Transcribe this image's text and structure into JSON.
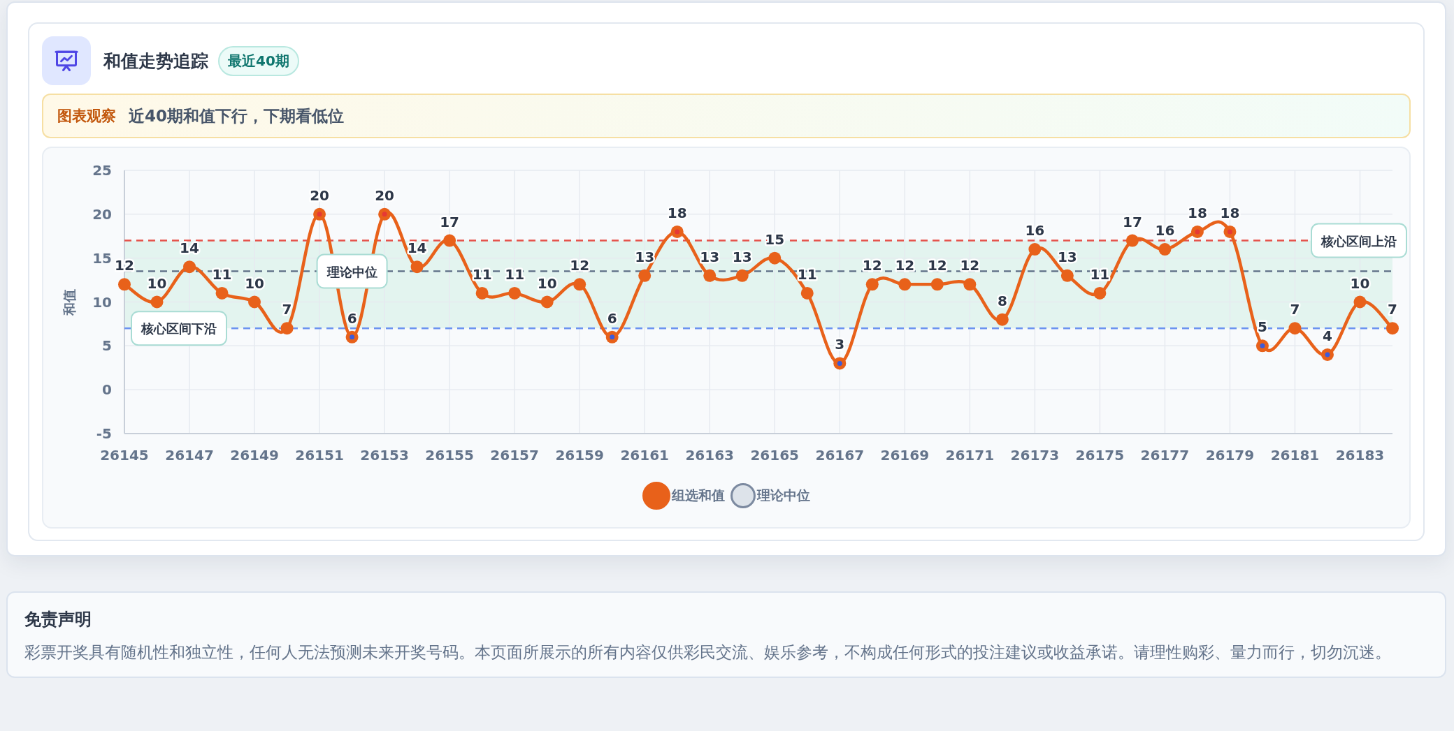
{
  "header": {
    "title": "和值走势追踪",
    "badge": "最近40期"
  },
  "observation": {
    "label": "图表观察",
    "text": "近40期和值下行，下期看低位"
  },
  "chart": {
    "chart_data": {
      "type": "line",
      "ylabel": "和值",
      "ylim": [
        -5,
        25
      ],
      "yticks": [
        -5,
        0,
        5,
        10,
        15,
        20,
        25
      ],
      "xlim": [
        26145,
        26184
      ],
      "data_labels": true,
      "grid": true,
      "x": [
        26145,
        26146,
        26147,
        26148,
        26149,
        26150,
        26151,
        26152,
        26153,
        26154,
        26155,
        26156,
        26157,
        26158,
        26159,
        26160,
        26161,
        26162,
        26163,
        26164,
        26165,
        26166,
        26167,
        26168,
        26169,
        26170,
        26171,
        26172,
        26173,
        26174,
        26175,
        26176,
        26177,
        26178,
        26179,
        26180,
        26181,
        26182,
        26183,
        26184
      ],
      "xticks": [
        26145,
        26147,
        26149,
        26151,
        26153,
        26155,
        26157,
        26159,
        26161,
        26163,
        26165,
        26167,
        26169,
        26171,
        26173,
        26175,
        26177,
        26179,
        26181,
        26183
      ],
      "series": [
        {
          "name": "组选和值",
          "color": "#e8611a",
          "marker": "circle",
          "values": [
            12,
            10,
            14,
            11,
            10,
            7,
            20,
            6,
            20,
            14,
            17,
            11,
            11,
            10,
            12,
            6,
            13,
            18,
            13,
            13,
            15,
            11,
            3,
            12,
            12,
            12,
            12,
            8,
            16,
            13,
            11,
            17,
            16,
            18,
            18,
            5,
            7,
            4,
            10,
            7
          ]
        }
      ],
      "bands": [
        {
          "axis": "y",
          "from": 7,
          "to": 17,
          "color": "#e3f4ef"
        }
      ],
      "ref_lines": [
        {
          "axis": "y",
          "value": 17,
          "label": "核心区间上沿",
          "color": "#e5534b"
        },
        {
          "axis": "y",
          "value": 13.5,
          "label": "理论中位",
          "color": "#64748b"
        },
        {
          "axis": "y",
          "value": 7,
          "label": "核心区间下沿",
          "color": "#6b93f0"
        }
      ]
    },
    "legend": [
      {
        "label": "理论中位",
        "color": "#dde3ea"
      }
    ]
  },
  "disclaimer": {
    "title": "免责声明",
    "text": "彩票开奖具有随机性和独立性，任何人无法预测未来开奖号码。本页面所展示的所有内容仅供彩民交流、娱乐参考，不构成任何形式的投注建议或收益承诺。请理性购彩、量力而行，切勿沉迷。"
  }
}
